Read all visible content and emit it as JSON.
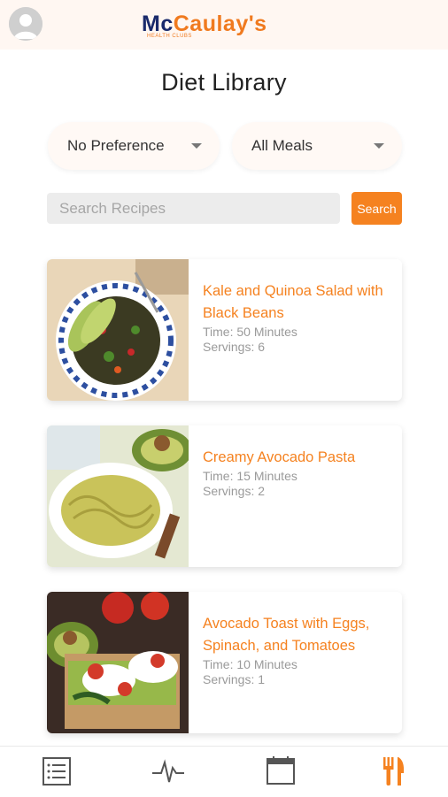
{
  "header": {
    "logo_text_mc": "Mc",
    "logo_text_rest": "Caulay's",
    "logo_sub": "HEALTH CLUBS",
    "avatar_icon": "user-avatar-icon"
  },
  "page_title": "Diet Library",
  "filters": {
    "preference": "No Preference",
    "meals": "All Meals"
  },
  "search": {
    "placeholder": "Search Recipes",
    "button_label": "Search"
  },
  "recipes": [
    {
      "name": "Kale and Quinoa Salad with Black Beans",
      "time": "Time: 50 Minutes",
      "servings": "Servings: 6"
    },
    {
      "name": "Creamy Avocado Pasta",
      "time": "Time: 15 Minutes",
      "servings": "Servings: 2"
    },
    {
      "name": "Avocado Toast with Eggs, Spinach, and Tomatoes",
      "time": "Time: 10 Minutes",
      "servings": "Servings: 1"
    }
  ],
  "bottom_nav": {
    "items": [
      "list-icon",
      "pulse-icon",
      "calendar-icon",
      "fork-knife-icon"
    ],
    "active_color": "#f58220",
    "inactive_color": "#555555"
  },
  "colors": {
    "accent": "#f58220",
    "header_bg": "#fff7f2",
    "brand_navy": "#1a2a6b"
  }
}
